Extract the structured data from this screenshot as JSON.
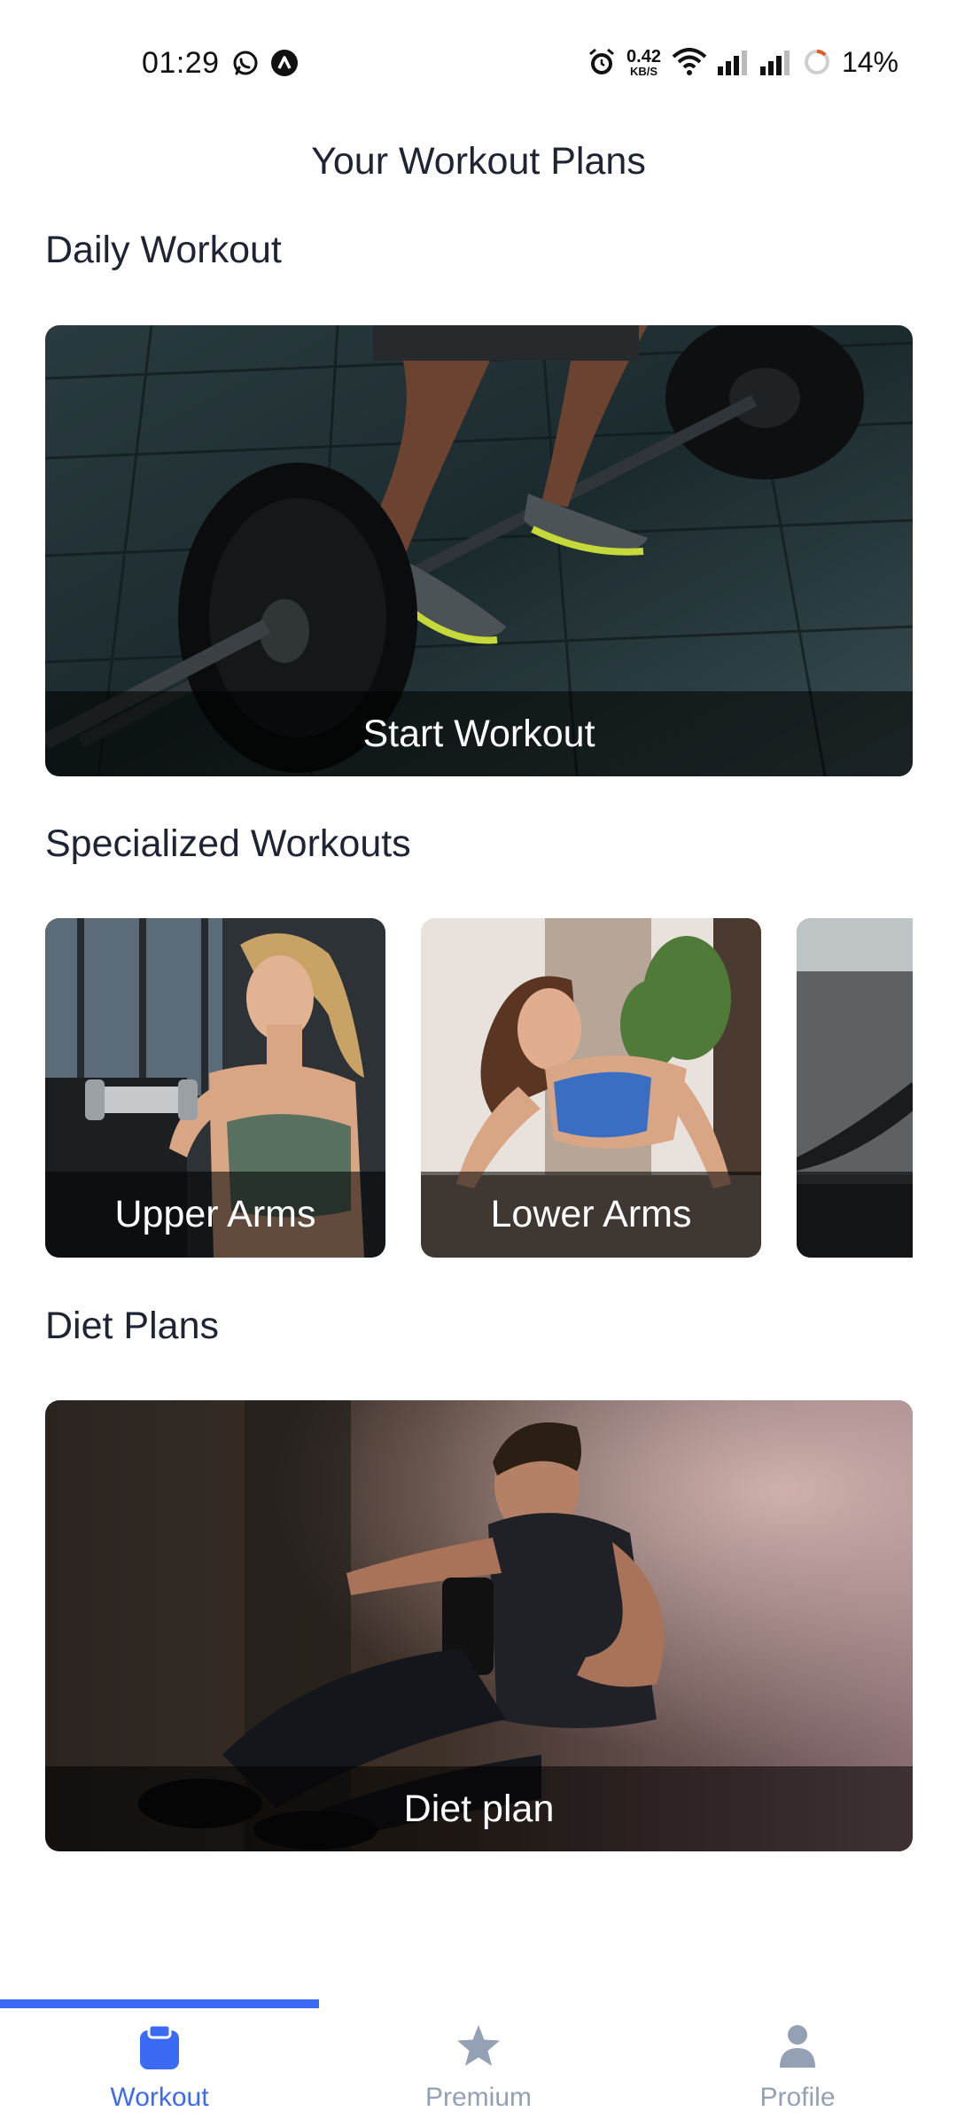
{
  "status_bar": {
    "time": "01:29",
    "app_icons": [
      "whatsapp-icon",
      "app-a-icon"
    ],
    "net_speed_value": "0.42",
    "net_speed_unit": "KB/S",
    "battery_percent": "14%"
  },
  "page": {
    "title": "Your Workout Plans"
  },
  "daily": {
    "heading": "Daily Workout",
    "card_label": "Start Workout"
  },
  "specialized": {
    "heading": "Specialized Workouts",
    "items": [
      {
        "label": "Upper Arms"
      },
      {
        "label": "Lower Arms"
      },
      {
        "label": ""
      }
    ]
  },
  "diet": {
    "heading": "Diet Plans",
    "card_label": "Diet plan"
  },
  "bottom_nav": {
    "items": [
      {
        "label": "Workout",
        "icon": "clipboard-icon",
        "active": true
      },
      {
        "label": "Premium",
        "icon": "star-icon",
        "active": false
      },
      {
        "label": "Profile",
        "icon": "person-icon",
        "active": false
      }
    ],
    "active_color": "#3b6bf5",
    "inactive_color": "#94a0b4"
  }
}
